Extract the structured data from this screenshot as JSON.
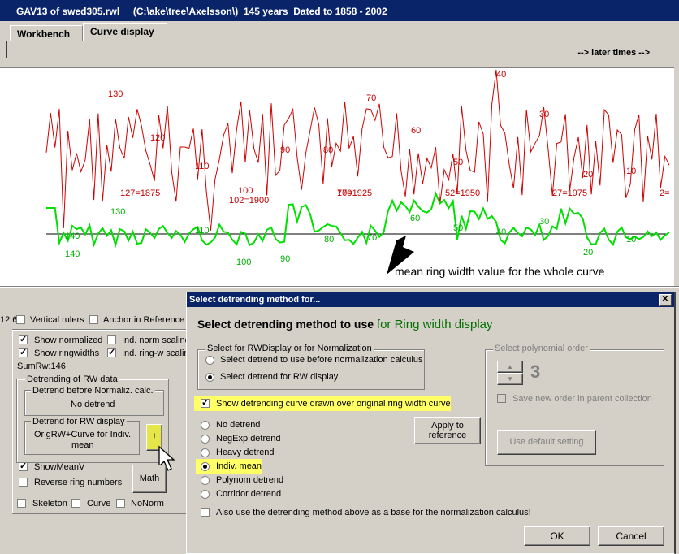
{
  "window": {
    "title": "GAV13 of swed305.rwl     (C:\\ake\\tree\\Axelsson\\)  145 years  Dated to 1858 - 2002"
  },
  "tabs": [
    {
      "label": "Workbench"
    },
    {
      "label": "Curve display"
    }
  ],
  "toolbar": {
    "later_times": "--> later times -->"
  },
  "chart": {
    "red_labels": [
      "130",
      "120",
      "110",
      "100",
      "127=1875",
      "102=1900",
      "100",
      "90",
      "80",
      "77=1925",
      "70",
      "60",
      "52=1950",
      "50",
      "40",
      "30",
      "27=1975",
      "20",
      "10",
      "2="
    ],
    "green_labels": [
      "140",
      "140",
      "130",
      "110",
      "100",
      "90",
      "80",
      "70",
      "60",
      "50",
      "40",
      "30",
      "20",
      "10"
    ],
    "annotation": "mean ring width value for the whole curve",
    "colors": {
      "ring_width": "#d00000",
      "detrend": "#00e000",
      "mean_line": "#000000"
    }
  },
  "left_panel": {
    "fragment": "12.6",
    "vertical_rulers": "Vertical rulers",
    "anchor": "Anchor in Reference",
    "show_normalized": "Show normalized",
    "ind_norm_scaling": "Ind. norm scaling",
    "show_ringwidths": "Show ringwidths",
    "ind_rw_scaling": "Ind. ring-w scalin",
    "sumrw": "SumRw:146",
    "detrending_group": "Detrending of RW data",
    "detrend_before": "Detrend before Normaliz. calc.",
    "no_detrend": "No detrend",
    "detrend_for_rw": "Detrend for RW display",
    "detrend_value_1": "OrigRW+Curve for Indiv.",
    "detrend_value_2": "mean",
    "exclaim_btn": "!",
    "show_mean_v": "ShowMeanV",
    "reverse_ring": "Reverse ring numbers",
    "math_btn": "Math",
    "skeleton": "Skeleton",
    "curve": "Curve",
    "nonorm": "NoNorm"
  },
  "dialog": {
    "title": "Select detrending method for...",
    "close": "✕",
    "heading_black": "Select detrending method to use",
    "heading_green": "for Ring width display",
    "group1_title": "Select for RWDisplay or for Normalization",
    "opt_before": "Select detrend to use before normalization calculus",
    "opt_rw": "Select detrend for RW display",
    "show_detrend_curve": "Show detrending curve drawn over original ring width curve",
    "methods": [
      "No detrend",
      "NegExp detrend",
      "Heavy detrend",
      "Indiv. mean",
      "Polynom detrend",
      "Corridor detrend"
    ],
    "apply_btn_1": "Apply to",
    "apply_btn_2": "reference",
    "poly_title": "Select polynomial order",
    "poly_value": "3",
    "save_order": "Save new order in parent collection",
    "use_default": "Use default setting",
    "also_use": "Also use the detrending method above as a base for the normalization calculus!",
    "ok": "OK",
    "cancel": "Cancel"
  }
}
